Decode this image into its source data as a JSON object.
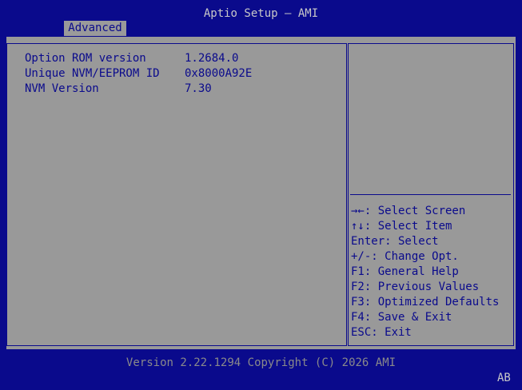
{
  "header": {
    "title": "Aptio Setup – AMI"
  },
  "tabs": [
    {
      "label": "Advanced",
      "active": true
    }
  ],
  "main": {
    "rows": [
      {
        "label": "Option ROM version",
        "value": "1.2684.0"
      },
      {
        "label": "Unique NVM/EEPROM ID",
        "value": "0x8000A92E"
      },
      {
        "label": "NVM Version",
        "value": "7.30"
      }
    ]
  },
  "help": {
    "keys": [
      "→←: Select Screen",
      "↑↓: Select Item",
      "Enter: Select",
      "+/-: Change Opt.",
      "F1: General Help",
      "F2: Previous Values",
      "F3: Optimized Defaults",
      "F4: Save & Exit",
      "ESC: Exit"
    ]
  },
  "footer": {
    "version": "Version 2.22.1294 Copyright (C) 2026 AMI",
    "corner": "AB"
  },
  "colors": {
    "frame": "#0a0a8c",
    "panel": "#999999",
    "tab_bg": "#9a9a9a",
    "text": "#0a0a8c",
    "title_text": "#c8c8c8",
    "footer_text": "#8a8a8a"
  }
}
